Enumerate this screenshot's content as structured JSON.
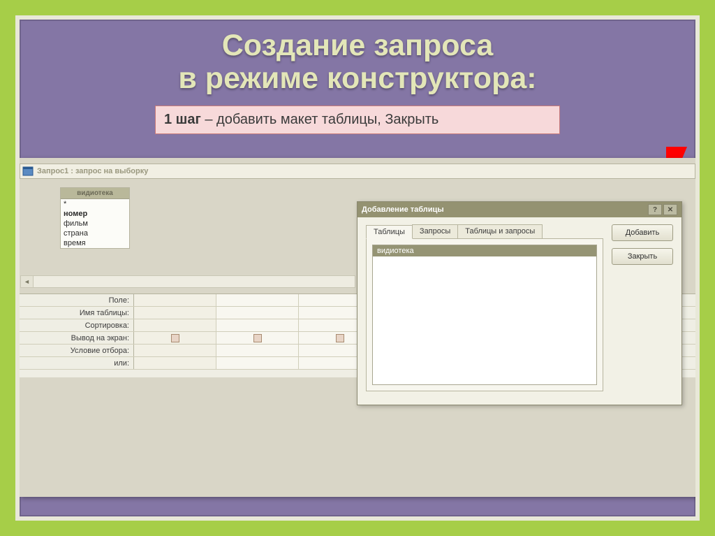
{
  "slide": {
    "title_line1": "Создание запроса",
    "title_line2": "в режиме конструктора:",
    "step_bold": "1 шаг",
    "step_rest": " – добавить макет таблицы, Закрыть"
  },
  "query_window": {
    "title": "Запрос1 : запрос на выборку"
  },
  "table_panel": {
    "header": "видиотека",
    "fields": [
      "*",
      "номер",
      "фильм",
      "страна",
      "время"
    ]
  },
  "grid_labels": {
    "field": "Поле:",
    "table": "Имя таблицы:",
    "sort": "Сортировка:",
    "show": "Вывод на экран:",
    "criteria": "Условие отбора:",
    "or": "или:"
  },
  "dialog": {
    "title": "Добавление таблицы",
    "tabs": [
      "Таблицы",
      "Запросы",
      "Таблицы и запросы"
    ],
    "list_items": [
      "видиотека"
    ],
    "add_btn": "Добавить",
    "close_btn": "Закрыть"
  }
}
